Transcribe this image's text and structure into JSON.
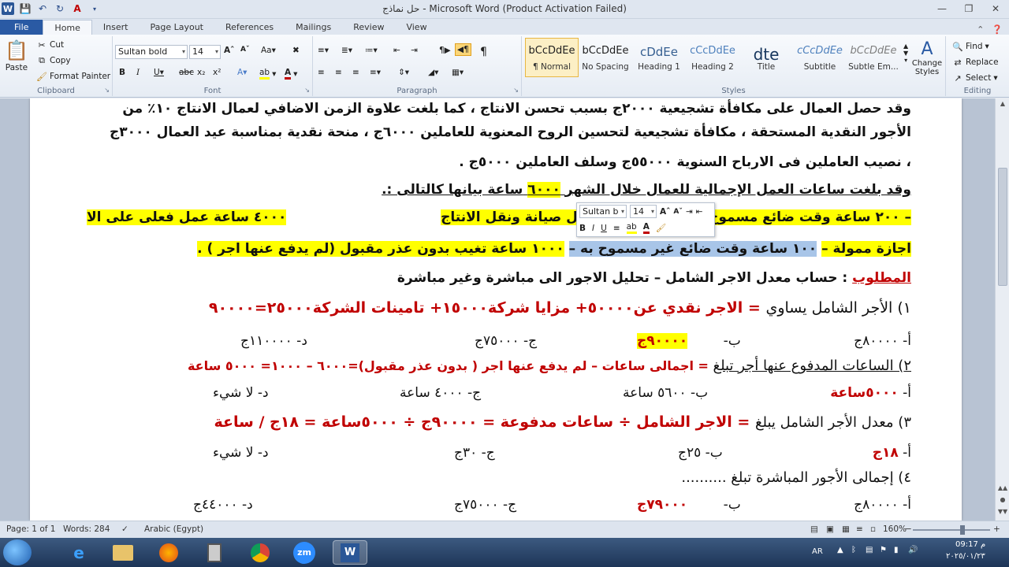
{
  "window": {
    "title": "حل نماذج - Microsoft Word (Product Activation Failed)",
    "app_letter": "W"
  },
  "tabs": [
    "File",
    "Home",
    "Insert",
    "Page Layout",
    "References",
    "Mailings",
    "Review",
    "View"
  ],
  "clipboard": {
    "paste": "Paste",
    "cut": "Cut",
    "copy": "Copy",
    "format_painter": "Format Painter",
    "label": "Clipboard"
  },
  "font": {
    "name": "Sultan bold",
    "size": "14",
    "label": "Font"
  },
  "paragraph": {
    "label": "Paragraph"
  },
  "styles": {
    "label": "Styles",
    "items": [
      {
        "sample": "bCcDdEe",
        "name": "¶ Normal"
      },
      {
        "sample": "bCcDdEe",
        "name": "No Spacing"
      },
      {
        "sample": "cDdEe",
        "name": "Heading 1"
      },
      {
        "sample": "cCcDdEe",
        "name": "Heading 2"
      },
      {
        "sample": "dte",
        "name": "Title"
      },
      {
        "sample": "cCcDdEe",
        "name": "Subtitle"
      },
      {
        "sample": "bCcDdEe",
        "name": "Subtle Em..."
      }
    ],
    "change": "Change Styles"
  },
  "editing": {
    "find": "Find",
    "replace": "Replace",
    "select": "Select",
    "label": "Editing"
  },
  "doc": {
    "l1": "وقد حصل العمال على مكافأة تشجيعية ٢٠٠٠ج بسبب تحسن الانتاج ، كما بلغت علاوة الزمن الاضافي لعمال الانتاج ١٠٪ من",
    "l2": "الأجور النقدية المستحقة ، مكافأة تشجيعية لتحسين الروح المعنوية للعاملين ٦٠٠٠ج ، منحة نقدية بمناسبة عيد العمال ٣٠٠٠ج",
    "l3": "، نصيب العاملين فى الارباح السنوية ٥٥٠٠٠ج وسلف العاملين ٥٠٠٠ج .",
    "l4a": "وقد بلغت ساعات العمل الإجمالية للعمال خلال الشهر",
    "l4b": "٦٠٠٠",
    "l4c": "ساعة بيانها كالتالى :.",
    "l5a": "٤٠٠٠ ساعة عمل فعلى على الا",
    "l5b": "اعمال صيانة ونقل الانتاج",
    "l5c": "– ٢٠٠ ساعة وقت ضائع مسموح به – ٣٠٠ ساعة",
    "l6a": "اجازة ممولة –",
    "l6b": "١٠٠ ساعة وقت ضائع غير مسموح به –",
    "l6c": "١٠٠٠ ساعة تغيب بدون عذر مقبول (لم يدفع عنها اجر ) .",
    "l7a": "المطلوب",
    "l7b": ": حساب معدل الاجر الشامل – تحليل الاجور الى مباشرة وغير مباشرة",
    "q1a": "١) الأجر الشامل يساوي",
    "q1b": "= الاجر نقدي عن٥٠٠٠٠+ مزايا شركة١٥٠٠٠+ تامينات الشركة٢٥٠٠٠=٩٠٠٠٠",
    "q1_opt_a": "أ- ٨٠٠٠٠ج",
    "q1_opt_b_pre": "ب-",
    "q1_opt_b": "٩٠٠٠٠ج",
    "q1_opt_c": "ج- ٧٥٠٠٠ج",
    "q1_opt_d": "د- ١١٠٠٠٠ج",
    "q2a": "٢) الساعات المدفوع عنها أجر تبلغ",
    "q2b": "= اجمالى ساعات – لم يدفع عنها اجر ( بدون عذر مقبول)=٦٠٠٠ – ١٠٠٠= ٥٠٠٠ ساعة",
    "q2_opt_a_pre": "أ-",
    "q2_opt_a": "٥٠٠٠ساعة",
    "q2_opt_b": "ب- ٥٦٠٠ ساعة",
    "q2_opt_c": "ج- ٤٠٠٠ ساعة",
    "q2_opt_d": "د- لا شيء",
    "q3a": "٣) معدل الأجر الشامل يبلغ",
    "q3b": "= الاجر الشامل ÷ ساعات مدفوعة = ٩٠٠٠٠ج ÷ ٥٠٠٠ساعة = ١٨ج / ساعة",
    "q3_opt_a_pre": "أ-",
    "q3_opt_a": "١٨ج",
    "q3_opt_b": "ب- ٢٥ج",
    "q3_opt_c": "ج- ٣٠ج",
    "q3_opt_d": "د- لا شيء",
    "q4a": "٤) إجمالى الأجور المباشرة تبلغ ..........",
    "q4_opt_a": "أ- ٨٠٠٠٠ج",
    "q4_opt_b_pre": "ب-",
    "q4_opt_b": "٧٩٠٠٠ج",
    "q4_opt_c": "ج- ٧٥٠٠٠ج",
    "q4_opt_d": "د- ٤٤٠٠٠ج"
  },
  "mini_toolbar": {
    "font": "Sultan b",
    "size": "14"
  },
  "status": {
    "page": "Page: 1 of 1",
    "words": "Words: 284",
    "lang": "Arabic (Egypt)",
    "zoom": "160%"
  },
  "tray": {
    "lang": "AR",
    "time": "09:17 م",
    "date": "٢٠٢٥/٠١/٢٣"
  },
  "colors": {
    "highlight": "#ffff00",
    "red_text": "#c00000",
    "file_tab": "#2a5aa4"
  }
}
